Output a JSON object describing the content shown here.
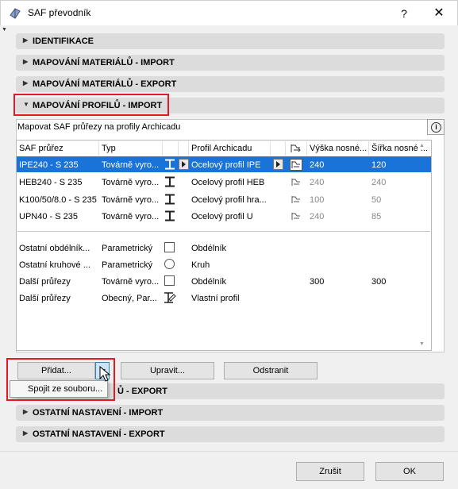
{
  "window": {
    "title": "SAF převodník",
    "help_label": "?",
    "close_label": "✕"
  },
  "sections": {
    "identifikace": "IDENTIFIKACE",
    "mat_import": "MAPOVÁNÍ MATERIÁLŮ - IMPORT",
    "mat_export": "MAPOVÁNÍ MATERIÁLŮ - EXPORT",
    "prof_import": "MAPOVÁNÍ PROFILŮ - IMPORT",
    "prof_export_partial": "Ů - EXPORT",
    "ost_import": "OSTATNÍ NASTAVENÍ - IMPORT",
    "ost_export": "OSTATNÍ NASTAVENÍ - EXPORT"
  },
  "panel": {
    "map_label": "Mapovat SAF průřezy na profily Archicadu",
    "info_label": "i"
  },
  "columns": {
    "saf": "SAF průřez",
    "typ": "Typ",
    "profil": "Profil Archicadu",
    "vyska": "Výška nosné...",
    "sirka": "Šířka nosné ..."
  },
  "rows": [
    {
      "saf": "IPE240 - S 235",
      "typ": "Továrně vyro...",
      "profil": "Ocelový profil IPE",
      "vyska": "240",
      "sirka": "120",
      "selected": true
    },
    {
      "saf": "HEB240 - S 235",
      "typ": "Továrně vyro...",
      "profil": "Ocelový profil HEB",
      "vyska": "240",
      "sirka": "240"
    },
    {
      "saf": "K100/50/8.0 - S 235",
      "typ": "Továrně vyro...",
      "profil": "Ocelový profil hra...",
      "vyska": "100",
      "sirka": "50"
    },
    {
      "saf": "UPN40 - S 235",
      "typ": "Továrně vyro...",
      "profil": "Ocelový profil U",
      "vyska": "240",
      "sirka": "85"
    }
  ],
  "other_rows": [
    {
      "saf": "Ostatní obdélník...",
      "typ": "Parametrický",
      "profil": "Obdélník",
      "shape": "square-icon"
    },
    {
      "saf": "Ostatní kruhové ...",
      "typ": "Parametrický",
      "profil": "Kruh",
      "shape": "circle-icon"
    },
    {
      "saf": "Další průřezy",
      "typ": "Továrně vyro...",
      "profil": "Obdélník",
      "vyska": "300",
      "sirka": "300",
      "shape": "square-icon"
    },
    {
      "saf": "Další průřezy",
      "typ": "Obecný, Par...",
      "profil": "Vlastní profil",
      "shape": "custom-profile-icon"
    }
  ],
  "buttons": {
    "pridat": "Přidat...",
    "upravit": "Upravit...",
    "odstranit": "Odstranit",
    "zrusit": "Zrušit",
    "ok": "OK"
  },
  "dropdown": {
    "item": "Spojit ze souboru..."
  },
  "colors": {
    "selection": "#1a73d9",
    "highlight": "#e11b22",
    "section_bg": "#dcdcdc"
  }
}
